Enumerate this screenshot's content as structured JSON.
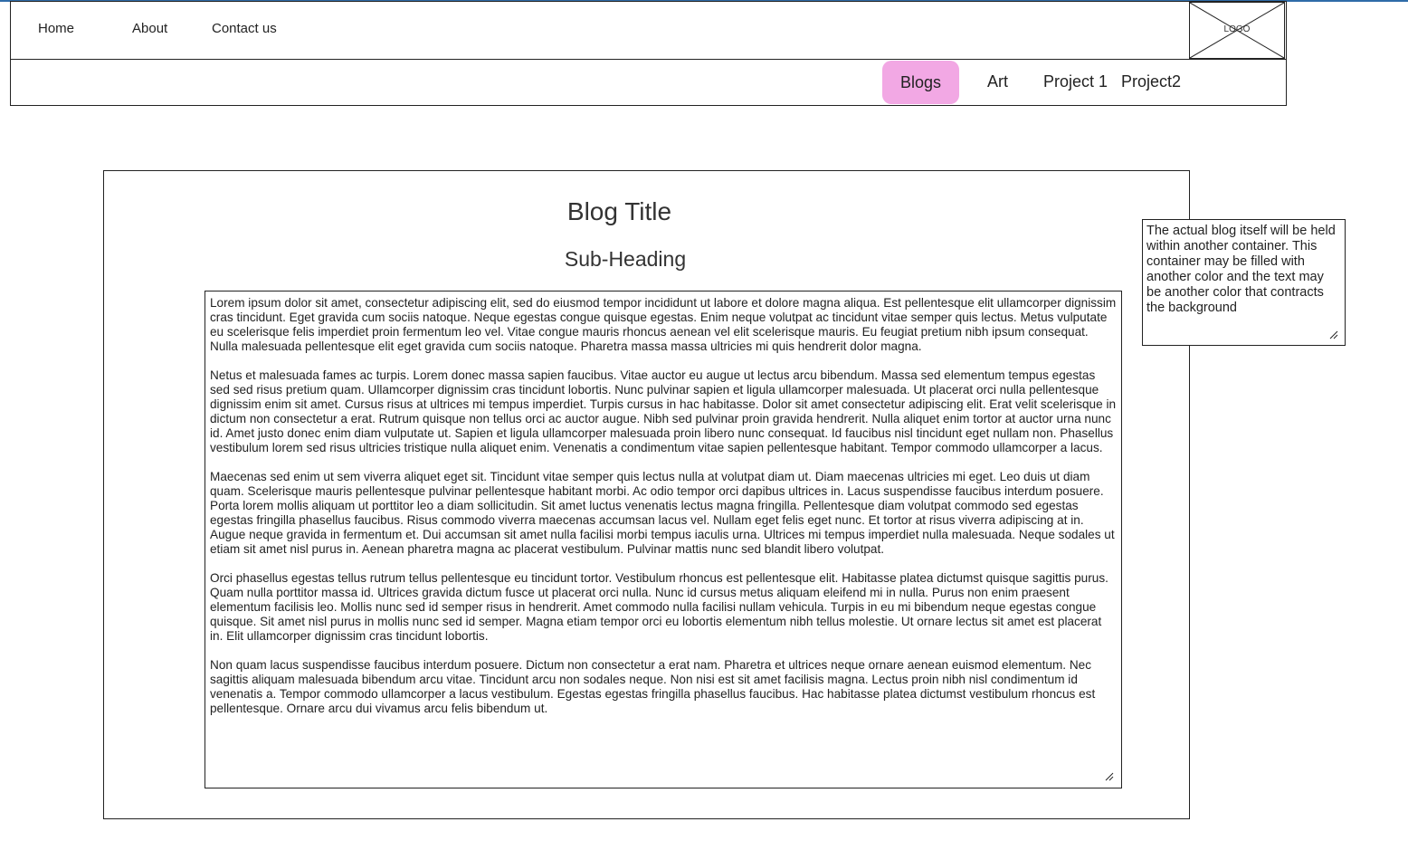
{
  "header": {
    "nav": [
      "Home",
      "About",
      "Contact us"
    ],
    "logo_label": "LOGO"
  },
  "subnav": {
    "items": [
      "Blogs",
      "Art",
      "Project 1",
      "Project2"
    ],
    "active_item": "Blogs",
    "active_color": "#f2a8e4"
  },
  "blog": {
    "title": "Blog Title",
    "subheading": "Sub-Heading",
    "paragraphs": [
      "Lorem ipsum dolor sit amet, consectetur adipiscing elit, sed do eiusmod tempor incididunt ut labore et dolore magna aliqua. Est pellentesque elit ullamcorper dignissim cras tincidunt. Eget gravida cum sociis natoque. Neque egestas congue quisque egestas. Enim neque volutpat ac tincidunt vitae semper quis lectus. Metus vulputate eu scelerisque felis imperdiet proin fermentum leo vel. Vitae congue mauris rhoncus aenean vel elit scelerisque mauris. Eu feugiat pretium nibh ipsum consequat. Nulla malesuada pellentesque elit eget gravida cum sociis natoque. Pharetra massa massa ultricies mi quis hendrerit dolor magna.",
      "Netus et malesuada fames ac turpis. Lorem donec massa sapien faucibus. Vitae auctor eu augue ut lectus arcu bibendum. Massa sed elementum tempus egestas sed sed risus pretium quam. Ullamcorper dignissim cras tincidunt lobortis. Nunc pulvinar sapien et ligula ullamcorper malesuada. Ut placerat orci nulla pellentesque dignissim enim sit amet. Cursus risus at ultrices mi tempus imperdiet. Turpis cursus in hac habitasse. Dolor sit amet consectetur adipiscing elit. Erat velit scelerisque in dictum non consectetur a erat. Rutrum quisque non tellus orci ac auctor augue. Nibh sed pulvinar proin gravida hendrerit. Nulla aliquet enim tortor at auctor urna nunc id. Amet justo donec enim diam vulputate ut. Sapien et ligula ullamcorper malesuada proin libero nunc consequat. Id faucibus nisl tincidunt eget nullam non. Phasellus vestibulum lorem sed risus ultricies tristique nulla aliquet enim. Venenatis a condimentum vitae sapien pellentesque habitant. Tempor commodo ullamcorper a lacus.",
      "Maecenas sed enim ut sem viverra aliquet eget sit. Tincidunt vitae semper quis lectus nulla at volutpat diam ut. Diam maecenas ultricies mi eget. Leo duis ut diam quam. Scelerisque mauris pellentesque pulvinar pellentesque habitant morbi. Ac odio tempor orci dapibus ultrices in. Lacus suspendisse faucibus interdum posuere. Porta lorem mollis aliquam ut porttitor leo a diam sollicitudin. Sit amet luctus venenatis lectus magna fringilla. Pellentesque diam volutpat commodo sed egestas egestas fringilla phasellus faucibus. Risus commodo viverra maecenas accumsan lacus vel. Nullam eget felis eget nunc. Et tortor at risus viverra adipiscing at in. Augue neque gravida in fermentum et. Dui accumsan sit amet nulla facilisi morbi tempus iaculis urna. Ultrices mi tempus imperdiet nulla malesuada. Neque sodales ut etiam sit amet nisl purus in. Aenean pharetra magna ac placerat vestibulum. Pulvinar mattis nunc sed blandit libero volutpat.",
      "Orci phasellus egestas tellus rutrum tellus pellentesque eu tincidunt tortor. Vestibulum rhoncus est pellentesque elit. Habitasse platea dictumst quisque sagittis purus. Quam nulla porttitor massa id. Ultrices gravida dictum fusce ut placerat orci nulla. Nunc id cursus metus aliquam eleifend mi in nulla. Purus non enim praesent elementum facilisis leo. Mollis nunc sed id semper risus in hendrerit. Amet commodo nulla facilisi nullam vehicula. Turpis in eu mi bibendum neque egestas congue quisque. Sit amet nisl purus in mollis nunc sed id semper. Magna etiam tempor orci eu lobortis elementum nibh tellus molestie. Ut ornare lectus sit amet est placerat in. Elit ullamcorper dignissim cras tincidunt lobortis.",
      "Non quam lacus suspendisse faucibus interdum posuere. Dictum non consectetur a erat nam. Pharetra et ultrices neque ornare aenean euismod elementum. Nec sagittis aliquam malesuada bibendum arcu vitae. Tincidunt arcu non sodales neque. Non nisi est sit amet facilisis magna. Lectus proin nibh nisl condimentum id venenatis a. Tempor commodo ullamcorper a lacus vestibulum. Egestas egestas fringilla phasellus faucibus. Hac habitasse platea dictumst vestibulum rhoncus est pellentesque. Ornare arcu dui vivamus arcu felis bibendum ut."
    ]
  },
  "note": {
    "text": "The actual blog itself will be held within another container. This container may be filled with another color and the text may be another color that contracts the background"
  }
}
